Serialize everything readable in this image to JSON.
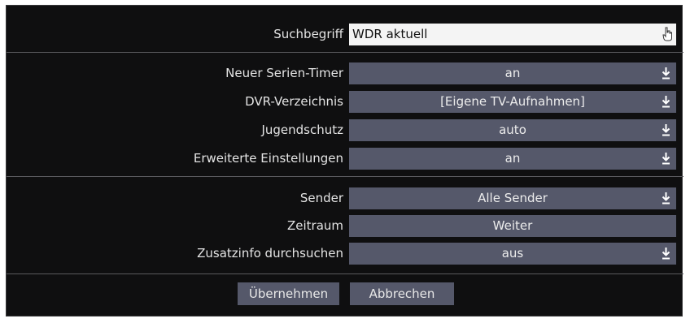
{
  "dialog": {
    "search": {
      "label": "Suchbegriff",
      "value": "WDR aktuell",
      "icon": "keyboard-hand-icon"
    },
    "group1": [
      {
        "label": "Neuer Serien-Timer",
        "value": "an",
        "icon": "dropdown-arrow-icon"
      },
      {
        "label": "DVR-Verzeichnis",
        "value": "[Eigene TV-Aufnahmen]",
        "icon": "dropdown-arrow-icon"
      },
      {
        "label": "Jugendschutz",
        "value": "auto",
        "icon": "dropdown-arrow-icon"
      },
      {
        "label": "Erweiterte Einstellungen",
        "value": "an",
        "icon": "dropdown-arrow-icon"
      }
    ],
    "group2": [
      {
        "label": "Sender",
        "value": "Alle Sender",
        "icon": "dropdown-arrow-icon"
      },
      {
        "label": "Zeitraum",
        "value": "Weiter"
      },
      {
        "label": "Zusatzinfo durchsuchen",
        "value": "aus",
        "icon": "dropdown-arrow-icon"
      }
    ],
    "buttons": {
      "apply": "Übernehmen",
      "cancel": "Abbrechen"
    }
  },
  "colors": {
    "background": "#0f0f10",
    "field": "#55586a",
    "text_field": "#f4f4f4",
    "separator": "#5a5a5e"
  }
}
